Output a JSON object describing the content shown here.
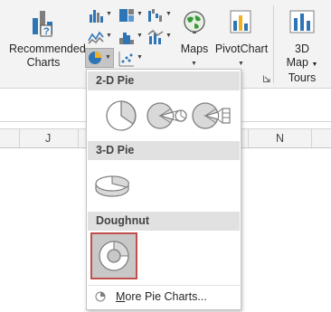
{
  "ribbon": {
    "recommended_charts": {
      "line1": "Recommended",
      "line2": "Charts"
    },
    "maps": {
      "label": "Maps"
    },
    "pivotchart": {
      "label": "PivotChart"
    },
    "map3d": {
      "line1": "3D",
      "line2": "Map"
    },
    "tours_group": "Tours"
  },
  "columns": [
    "J",
    "N"
  ],
  "dropdown": {
    "sections": {
      "pie2d": "2-D Pie",
      "pie3d": "3-D Pie",
      "doughnut": "Doughnut"
    },
    "more": {
      "first": "M",
      "rest": "ore Pie Charts..."
    }
  },
  "icons": {
    "recommended": "recommended-charts-icon",
    "maps": "globe-icon",
    "pivotchart": "pivotchart-icon",
    "map3d": "3d-map-icon",
    "pie": "pie-chart-icon",
    "pie_of_pie": "pie-of-pie-icon",
    "bar_of_pie": "bar-of-pie-icon",
    "pie_3d": "pie-3d-icon",
    "doughnut": "doughnut-icon"
  },
  "colors": {
    "selection_border": "#c0504d",
    "icon_blue": "#2e75b6",
    "section_bg": "#e1e1e1"
  }
}
